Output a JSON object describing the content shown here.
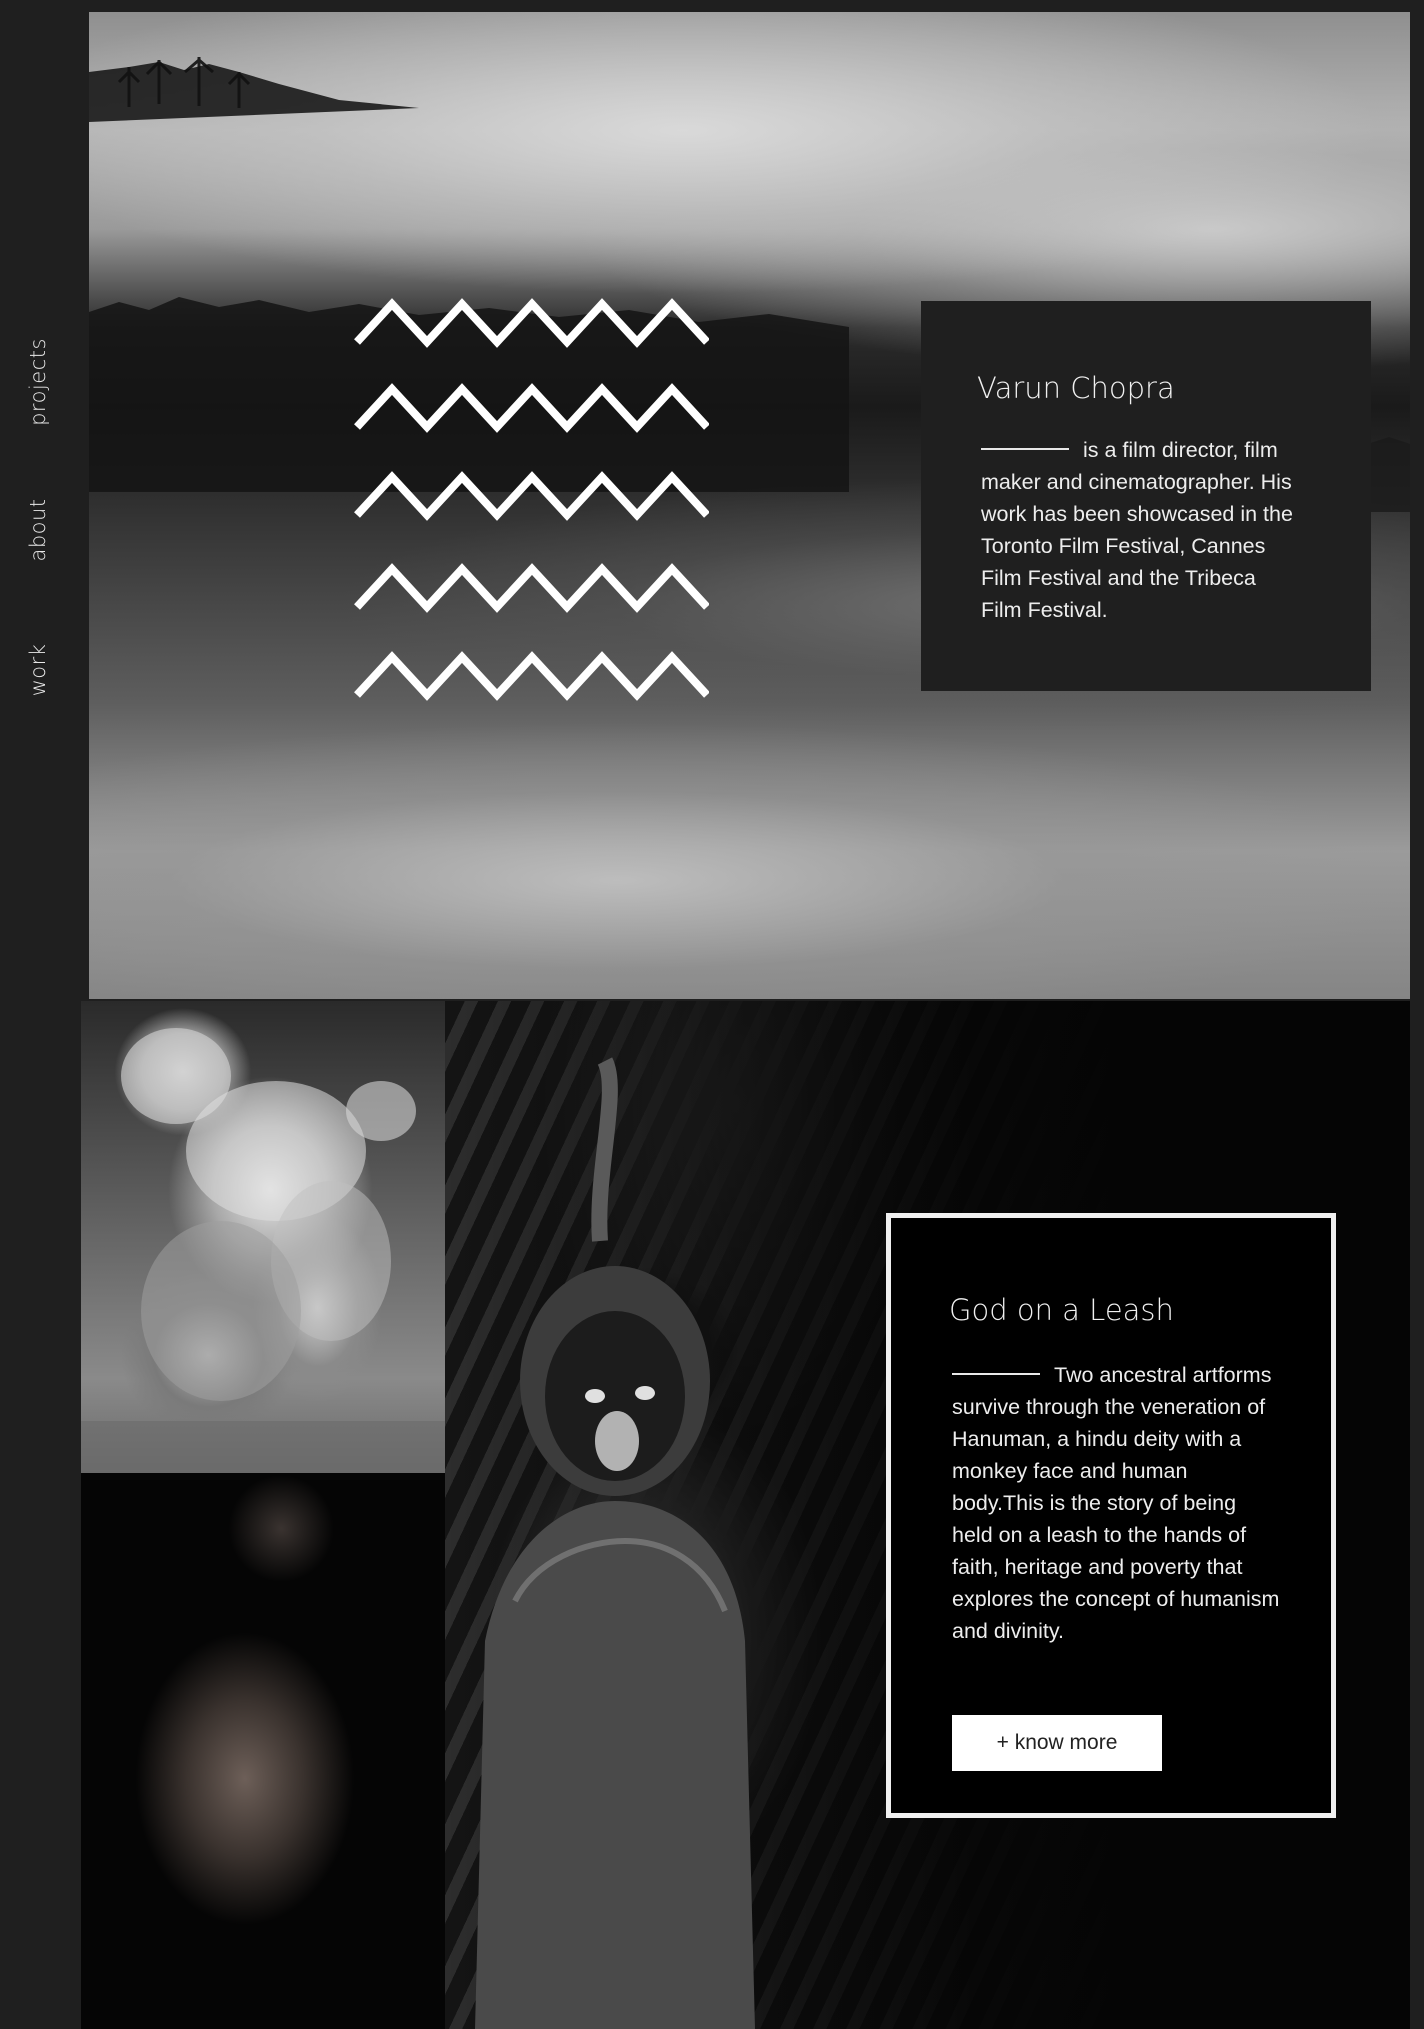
{
  "sidebar": {
    "items": [
      {
        "label": "projects"
      },
      {
        "label": "about"
      },
      {
        "label": "work"
      }
    ]
  },
  "hero": {
    "image": "misty-forest-landscape",
    "icon": "zigzag-pattern-icon",
    "intro": {
      "name": "Varun Chopra",
      "text": "is a film director, film maker and cinematographer. His work has been showcased in the Toronto Film Festival, Cannes Film Festival and the Tribeca Film Festival."
    }
  },
  "project": {
    "images": [
      "monkeys-photo",
      "bare-back-photo",
      "painted-performer-photo"
    ],
    "title": "God on a Leash",
    "text": "Two ancestral artforms survive through the veneration of Hanuman, a hindu deity with a monkey face and human body.This is the story of being held on a leash to the hands of faith, heritage and poverty that explores the concept of humanism and divinity.",
    "button_label": "+ know more"
  },
  "colors": {
    "background": "#1f1f1f",
    "text": "#ffffff",
    "button_bg": "#ffffff"
  }
}
